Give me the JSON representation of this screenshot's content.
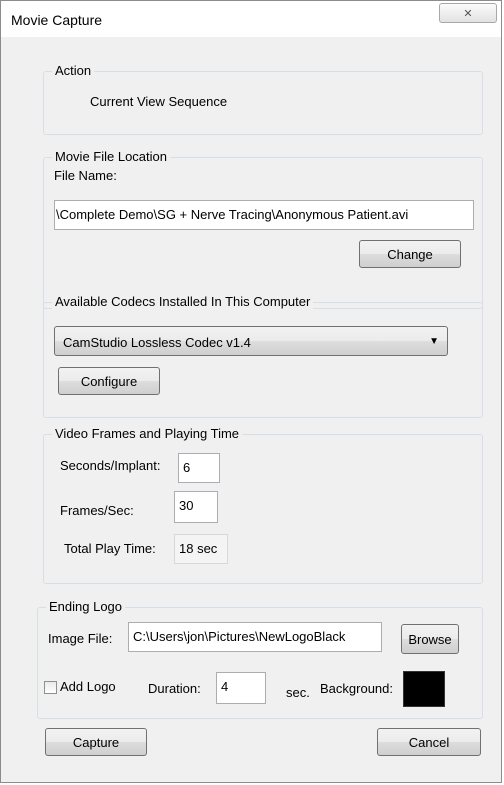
{
  "window": {
    "title": "Movie Capture",
    "close_glyph": "✕"
  },
  "action": {
    "legend": "Action",
    "value": "Current View Sequence"
  },
  "movie_file": {
    "legend": "Movie File Location",
    "file_name_label": "File Name:",
    "file_name_value": "\\Complete Demo\\SG + Nerve Tracing\\Anonymous Patient.avi",
    "change_label": "Change"
  },
  "codecs": {
    "legend": "Available Codecs Installed In This Computer",
    "selected": "CamStudio Lossless Codec v1.4",
    "configure_label": "Configure"
  },
  "frames": {
    "legend": "Video Frames and Playing Time",
    "seconds_label": "Seconds/Implant:",
    "seconds_value": "6",
    "fps_label": "Frames/Sec:",
    "fps_value": "30",
    "total_label": "Total Play Time:",
    "total_value": "18 sec"
  },
  "logo": {
    "legend": "Ending Logo",
    "image_file_label": "Image File:",
    "image_file_value": "C:\\Users\\jon\\Pictures\\NewLogoBlack",
    "browse_label": "Browse",
    "add_logo_label": "Add Logo",
    "add_logo_checked": false,
    "duration_label": "Duration:",
    "duration_value": "4",
    "sec_label": "sec.",
    "background_label": "Background:",
    "background_color": "#000000"
  },
  "buttons": {
    "capture_label": "Capture",
    "cancel_label": "Cancel"
  }
}
